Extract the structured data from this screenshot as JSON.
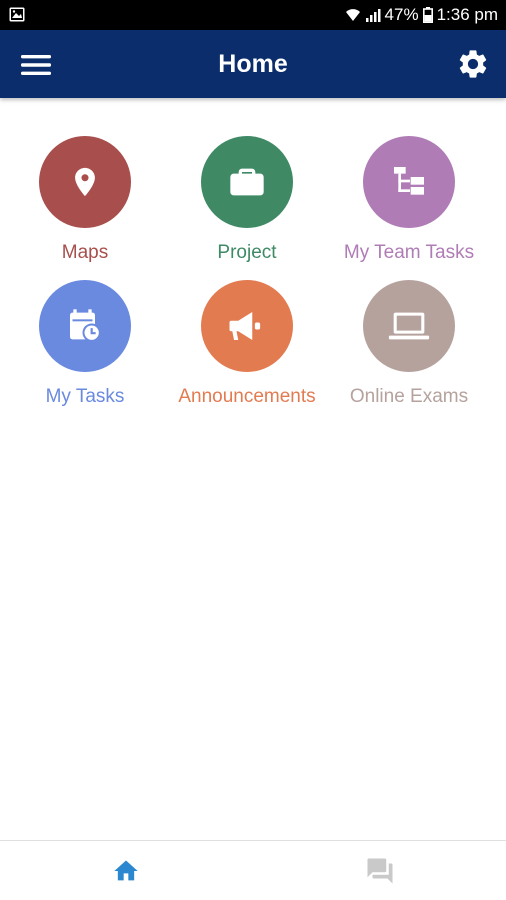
{
  "status_bar": {
    "battery": "47%",
    "time": "1:36 pm"
  },
  "app_bar": {
    "title": "Home"
  },
  "tiles": [
    {
      "label": "Maps",
      "icon": "map-pin-icon",
      "color": "#a84f4d"
    },
    {
      "label": "Project",
      "icon": "briefcase-icon",
      "color": "#3f8a65"
    },
    {
      "label": "My Team Tasks",
      "icon": "hierarchy-icon",
      "color": "#b07cb6"
    },
    {
      "label": "My Tasks",
      "icon": "calendar-clock-icon",
      "color": "#6a8ae0"
    },
    {
      "label": "Announcements",
      "icon": "megaphone-icon",
      "color": "#e37b51"
    },
    {
      "label": "Online Exams",
      "icon": "laptop-icon",
      "color": "#b6a29d"
    }
  ],
  "bottom_nav": {
    "active_color": "#2a87d0",
    "inactive_color": "#c9c9c9"
  }
}
